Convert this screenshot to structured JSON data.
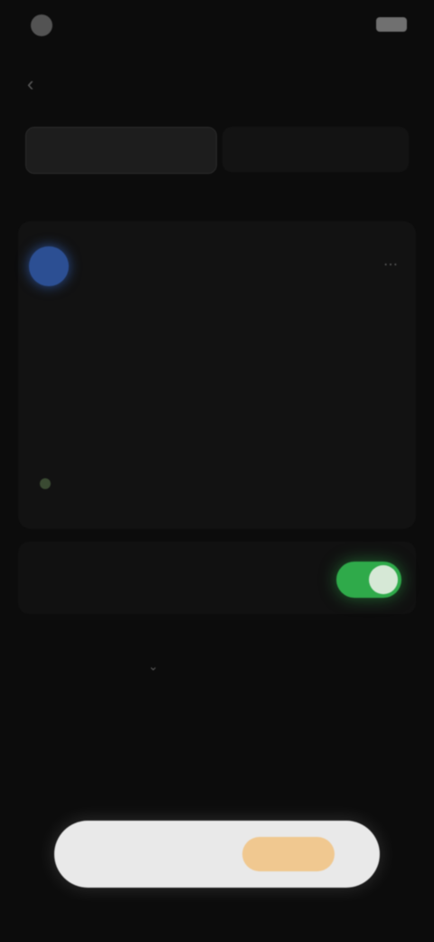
{
  "status_bar": {
    "time": "",
    "icons": "●●● ▮"
  },
  "nav": {
    "back_icon": "chevron-left"
  },
  "tabs": [
    {
      "label": "",
      "active": true
    },
    {
      "label": "",
      "active": false
    }
  ],
  "card": {
    "section_label": "",
    "name": "",
    "handle": "",
    "body": "",
    "meta_left": "",
    "meta_right": ""
  },
  "toggle": {
    "label": "",
    "state": "on"
  },
  "section": {
    "title": "",
    "items": [
      {
        "label": "",
        "value": ""
      },
      {
        "label": "",
        "value": ""
      },
      {
        "label": "",
        "value": ""
      }
    ]
  },
  "bottom_bar": {
    "left_label": "",
    "right_label": ""
  },
  "colors": {
    "background": "#0c0c0c",
    "avatar": "#2c4f93",
    "toggle_on": "#2faa4a",
    "bottom_bar": "#e9e9e9",
    "accent_button": "#f0c890"
  }
}
